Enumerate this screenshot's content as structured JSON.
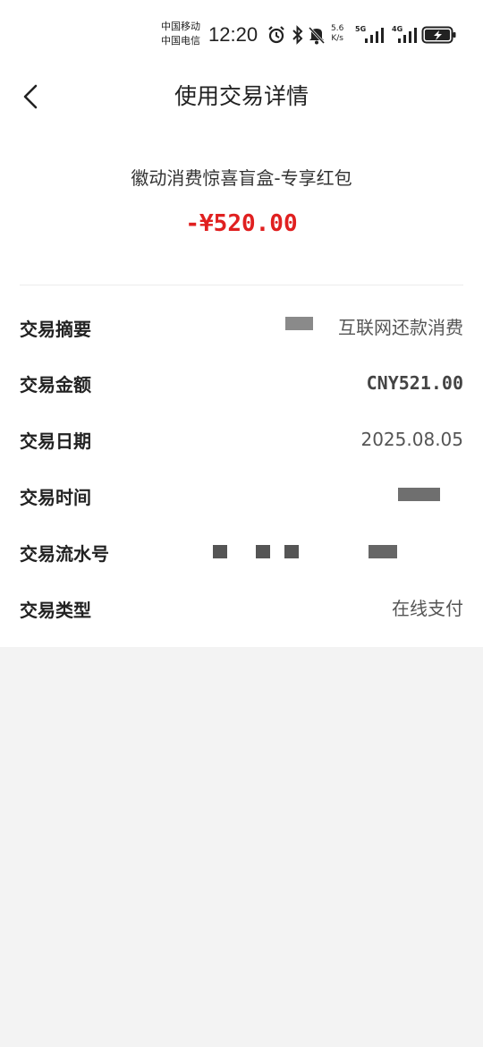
{
  "status_bar": {
    "carrier_1": "中国移动",
    "carrier_2": "中国电信",
    "time": "12:20",
    "net_speed_value": "5.6",
    "net_speed_unit": "K/s",
    "sim1_network": "5G",
    "sim2_network": "4G",
    "icons": [
      "alarm-icon",
      "bluetooth-icon",
      "mute-icon",
      "signal-icon",
      "battery-charging-icon"
    ]
  },
  "nav": {
    "title": "使用交易详情",
    "back_icon": "chevron-left-icon"
  },
  "summary": {
    "merchant": "徽动消费惊喜盲盒-专享红包",
    "amount": "-¥520.00"
  },
  "details": {
    "rows": [
      {
        "label": "交易摘要",
        "value": "互联网还款消费"
      },
      {
        "label": "交易金额",
        "value": "CNY521.00"
      },
      {
        "label": "交易日期",
        "value": "2025.08.05"
      },
      {
        "label": "交易时间",
        "value": ""
      },
      {
        "label": "交易流水号",
        "value": ""
      },
      {
        "label": "交易类型",
        "value": "在线支付"
      }
    ]
  },
  "colors": {
    "amount": "#e02020",
    "background": "#f3f3f3",
    "card": "#ffffff"
  }
}
